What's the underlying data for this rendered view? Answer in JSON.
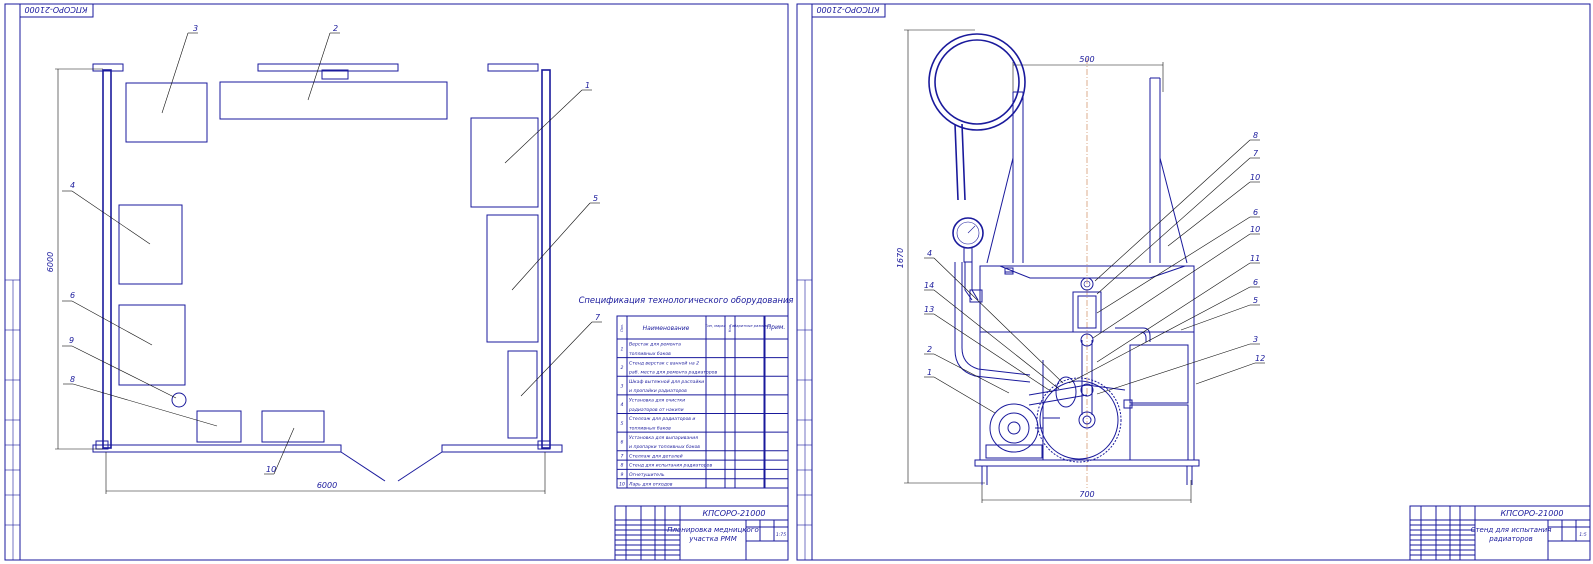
{
  "sheet1": {
    "stamp_corner": "КПСОРО-21000",
    "dimensions": {
      "width": "6000",
      "height": "6000"
    },
    "callouts": [
      "1",
      "2",
      "3",
      "4",
      "5",
      "6",
      "7",
      "8",
      "9",
      "10"
    ],
    "spec_title": "Спецификация технологического оборудования",
    "spec_headers": [
      "Поз.",
      "Наименование",
      "Тип, марка",
      "Кол.",
      "Габаритные размеры",
      "Прим."
    ],
    "spec_rows": [
      {
        "pos": "1",
        "lines": [
          "Верстак для ремонта",
          "топливных баков"
        ],
        "type": "",
        "qty": "",
        "size": ""
      },
      {
        "pos": "2",
        "lines": [
          "Стенд верстак с ванной на 2",
          "раб. места для ремонта радиаторов"
        ],
        "type": "",
        "qty": "",
        "size": ""
      },
      {
        "pos": "3",
        "lines": [
          "Шкаф вытяжной для распайки",
          "и пропайки радиаторов"
        ],
        "type": "",
        "qty": "",
        "size": ""
      },
      {
        "pos": "4",
        "lines": [
          "Установка для очистки",
          "радиаторов от накипи"
        ],
        "type": "",
        "qty": "",
        "size": ""
      },
      {
        "pos": "5",
        "lines": [
          "Стеллаж для радиаторов и",
          "топливных баков"
        ],
        "type": "",
        "qty": "",
        "size": ""
      },
      {
        "pos": "6",
        "lines": [
          "Установка для выпаривания",
          "и пропарки топливных баков"
        ],
        "type": "",
        "qty": "",
        "size": ""
      },
      {
        "pos": "7",
        "lines": [
          "Стеллаж для деталей"
        ],
        "type": "",
        "qty": "",
        "size": ""
      },
      {
        "pos": "8",
        "lines": [
          "Стенд для испытания радиаторов"
        ],
        "type": "",
        "qty": "",
        "size": ""
      },
      {
        "pos": "9",
        "lines": [
          "Огнетушитель"
        ],
        "type": "",
        "qty": "",
        "size": ""
      },
      {
        "pos": "10",
        "lines": [
          "Ларь для отходов"
        ],
        "type": "",
        "qty": "",
        "size": ""
      }
    ],
    "title_block": {
      "code": "КПСОРО-21000",
      "name_line1": "Планировка медницкого",
      "name_line2": "участка РММ",
      "scale": "1:75"
    }
  },
  "sheet2": {
    "stamp_corner": "КПСОРО-21000",
    "dimensions": {
      "top": "500",
      "height": "1670",
      "bottom": "700"
    },
    "callouts": [
      "8",
      "7",
      "10",
      "6",
      "10",
      "11",
      "6",
      "5",
      "3",
      "12",
      "4",
      "14",
      "13",
      "2",
      "1"
    ],
    "title_block": {
      "code": "КПСОРО-21000",
      "name_line1": "Стенд для испытания",
      "name_line2": "радиаторов",
      "scale": "1:5"
    }
  }
}
